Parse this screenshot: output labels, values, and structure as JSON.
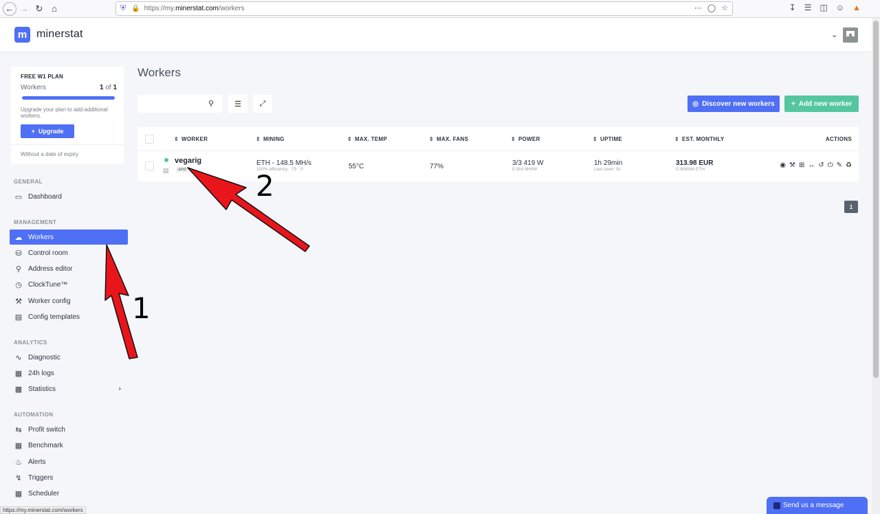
{
  "browser": {
    "url_prefix": "https://my.",
    "url_host": "minerstat.com",
    "url_path": "/workers",
    "status_url": "https://my.minerstat.com/workers"
  },
  "header": {
    "logo_letter": "m",
    "logo_text": "minerstat"
  },
  "plan": {
    "title": "FREE W1 PLAN",
    "workers_label": "Workers",
    "used": "1",
    "of_label": "of",
    "total": "1",
    "usage_fraction": 1.0,
    "description": "Upgrade your plan to add additional workers.",
    "upgrade_label": "Upgrade",
    "expiry": "Without a date of expiry"
  },
  "sidebar": {
    "sections": [
      {
        "label": "GENERAL"
      },
      {
        "label": "MANAGEMENT"
      },
      {
        "label": "ANALYTICS"
      },
      {
        "label": "AUTOMATION"
      }
    ],
    "items": [
      {
        "label": "Dashboard",
        "icon": "monitor-icon"
      },
      {
        "label": "Workers",
        "icon": "cloud-icon",
        "active": true
      },
      {
        "label": "Control room",
        "icon": "shield-icon"
      },
      {
        "label": "Address editor",
        "icon": "key-icon"
      },
      {
        "label": "ClockTune™",
        "icon": "gauge-icon"
      },
      {
        "label": "Worker config",
        "icon": "wrench-icon"
      },
      {
        "label": "Config templates",
        "icon": "document-icon"
      },
      {
        "label": "Diagnostic",
        "icon": "pulse-icon"
      },
      {
        "label": "24h logs",
        "icon": "calendar-icon"
      },
      {
        "label": "Statistics",
        "icon": "bar-chart-icon"
      },
      {
        "label": "Profit switch",
        "icon": "switch-icon"
      },
      {
        "label": "Benchmark",
        "icon": "benchmark-icon"
      },
      {
        "label": "Alerts",
        "icon": "bell-icon"
      },
      {
        "label": "Triggers",
        "icon": "bolt-icon"
      },
      {
        "label": "Scheduler",
        "icon": "calendar-icon"
      }
    ]
  },
  "main": {
    "title": "Workers",
    "search_placeholder": "",
    "discover_label": "Discover new workers",
    "add_label": "Add new worker"
  },
  "table": {
    "columns": [
      "WORKER",
      "MINING",
      "MAX. TEMP",
      "MAX. FANS",
      "POWER",
      "UPTIME",
      "EST. MONTHLY",
      "ACTIONS"
    ],
    "row": {
      "name": "vegarig",
      "tag": "amd",
      "mining": "ETH - 148.5 MH/s",
      "mining_sub": "100% efficiency · 79 · 0",
      "temp": "55°C",
      "fans": "77%",
      "power": "3/3 419 W",
      "power_sub": "0.354 MH/W",
      "uptime": "1h 29min",
      "uptime_sub": "Last seen: 3s",
      "monthly": "313.98 EUR",
      "monthly_sub": "0.308594 ETH"
    }
  },
  "pagination": {
    "page": "1"
  },
  "annotations": {
    "first": "1",
    "second": "2"
  },
  "chat": {
    "label": "Send us a message"
  },
  "colors": {
    "accent": "#4f6ff5",
    "success": "#55c7a0",
    "arrow": "#e8161b"
  }
}
